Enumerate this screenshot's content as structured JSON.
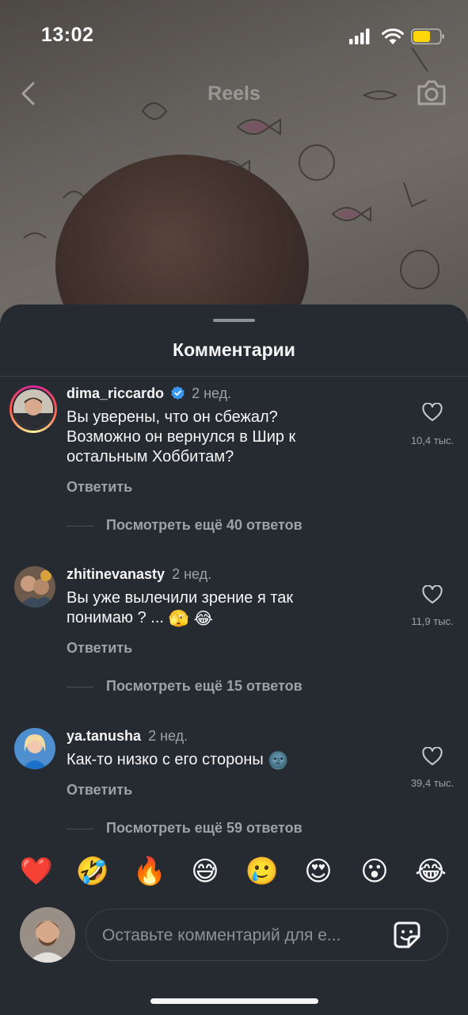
{
  "status_bar": {
    "time": "13:02",
    "battery_color": "#ffd60a"
  },
  "header": {
    "title": "Reels",
    "back_icon": "chevron-left-icon",
    "camera_icon": "camera-icon"
  },
  "sheet": {
    "title": "Комментарии"
  },
  "comments": [
    {
      "username": "dima_riccardo",
      "verified": true,
      "time": "2 нед.",
      "text": "Вы уверены, что он сбежал? Возможно он вернулся в Шир к остальным Хоббитам?",
      "reply_label": "Ответить",
      "likes": "10,4 тыс.",
      "more_replies": "Посмотреть ещё 40 ответов"
    },
    {
      "username": "zhitinevanasty",
      "verified": false,
      "time": "2 нед.",
      "text_line1": "Вы уже вылечили зрение я так",
      "text_line2": "понимаю ? ...",
      "emojis": "🫣 😂",
      "reply_label": "Ответить",
      "likes": "11,9 тыс.",
      "more_replies": "Посмотреть ещё 15 ответов"
    },
    {
      "username": "ya.tanusha",
      "verified": false,
      "time": "2 нед.",
      "text": "Как-то низко с его стороны",
      "emojis": "🌚",
      "reply_label": "Ответить",
      "likes": "39,4 тыс.",
      "more_replies": "Посмотреть ещё 59 ответов"
    }
  ],
  "reactions": [
    "❤️",
    "🤣",
    "🔥",
    "😅",
    "🥲",
    "😍",
    "😮",
    "😂"
  ],
  "composer": {
    "placeholder": "Оставьте комментарий для е...",
    "sticker_icon": "sticker-icon"
  },
  "colors": {
    "sheet_bg": "#262a31",
    "muted_text": "#9ea2a8",
    "verified": "#3897f0"
  }
}
